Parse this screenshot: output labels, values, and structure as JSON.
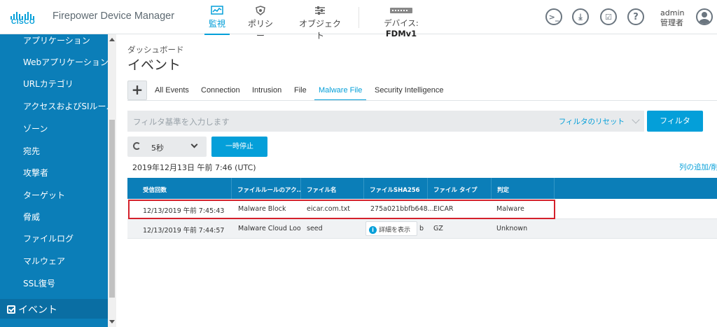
{
  "header": {
    "logo_text": "CISCO",
    "app_title": "Firepower Device Manager",
    "nav": [
      {
        "label": "監視",
        "icon": "monitoring-icon"
      },
      {
        "label": "ポリシー",
        "icon": "policy-shield-icon"
      },
      {
        "label": "オブジェクト",
        "icon": "objects-sliders-icon"
      }
    ],
    "device_prefix": "デバイス: ",
    "device_name": "FDMv1",
    "user_name": "admin",
    "user_role": "管理者"
  },
  "sidebar": {
    "items": [
      "アプリケーション",
      "Webアプリケーション",
      "URLカテゴリ",
      "アクセスおよびSIルール",
      "ゾーン",
      "宛先",
      "攻撃者",
      "ターゲット",
      "脅威",
      "ファイルログ",
      "マルウェア",
      "SSL復号"
    ],
    "events_label": "イベント"
  },
  "main": {
    "breadcrumb": "ダッシュボード",
    "title": "イベント",
    "tabs": [
      "All Events",
      "Connection",
      "Intrusion",
      "File",
      "Malware File",
      "Security Intelligence"
    ],
    "active_tab": "Malware File",
    "filter": {
      "placeholder": "フィルタ基準を入力します",
      "reset_label": "フィルタのリセット",
      "button_label": "フィルタ"
    },
    "refresh_value": "5秒",
    "pause_label": "一時停止",
    "timestamp": "2019年12月13日 午前 7:46 (UTC)",
    "add_columns_label": "列の追加/削"
  },
  "table": {
    "headers": [
      "受信回数",
      "ファイルルールのアク...",
      "ファイル名",
      "ファイルSHA256",
      "ファイル タイプ",
      "判定"
    ],
    "rows": [
      [
        "12/13/2019 午前 7:45:43",
        "Malware Block",
        "eicar.com.txt",
        "275a021bbfb648...",
        "EICAR",
        "Malware"
      ],
      [
        "12/13/2019 午前 7:44:57",
        "Malware Cloud Loo...",
        "seed",
        "b",
        "GZ",
        "Unknown"
      ]
    ],
    "popover_label": "詳細を表示"
  },
  "colors": {
    "accent": "#049fd9",
    "sidebar": "#0b7eb8",
    "highlight": "#d4212b"
  }
}
